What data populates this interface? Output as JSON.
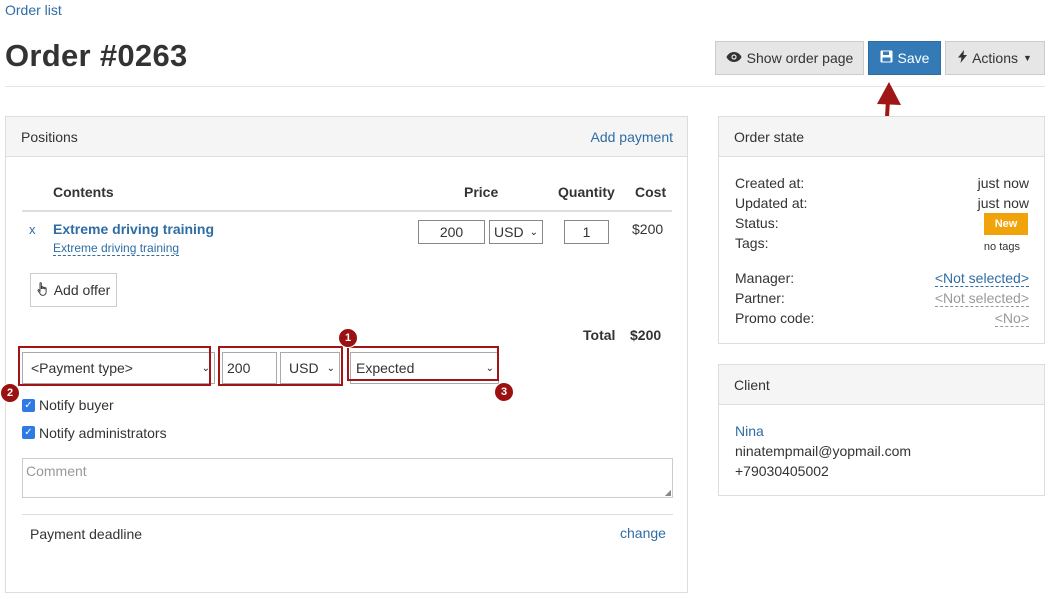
{
  "breadcrumb": {
    "order_list": "Order list"
  },
  "page": {
    "title": "Order #0263"
  },
  "toolbar": {
    "show_order_page": "Show order page",
    "save": "Save",
    "actions": "Actions"
  },
  "positions": {
    "heading": "Positions",
    "add_payment": "Add payment",
    "columns": {
      "contents": "Contents",
      "price": "Price",
      "quantity": "Quantity",
      "cost": "Cost"
    },
    "items": [
      {
        "remove": "x",
        "name": "Extreme driving training",
        "subtitle": "Extreme driving training",
        "price": "200",
        "currency": "USD",
        "quantity": "1",
        "cost": "$200"
      }
    ],
    "add_offer": "Add offer",
    "total_label": "Total",
    "total_value": "$200"
  },
  "payment": {
    "type_placeholder": "<Payment type>",
    "amount": "200",
    "currency": "USD",
    "status": "Expected",
    "notify_buyer": "Notify buyer",
    "notify_admins": "Notify administrators",
    "comment_placeholder": "Comment",
    "deadline_label": "Payment deadline",
    "deadline_change": "change"
  },
  "callouts": [
    "1",
    "2",
    "3"
  ],
  "order_state": {
    "heading": "Order state",
    "created_label": "Created at:",
    "created_value": "just now",
    "updated_label": "Updated at:",
    "updated_value": "just now",
    "status_label": "Status:",
    "status_value": "New",
    "tags_label": "Tags:",
    "tags_value": "no tags",
    "manager_label": "Manager:",
    "manager_value": "<Not selected>",
    "partner_label": "Partner:",
    "partner_value": "<Not selected>",
    "promo_label": "Promo code:",
    "promo_value": "<No>"
  },
  "client": {
    "heading": "Client",
    "name": "Nina",
    "email": "ninatempmail@yopmail.com",
    "phone": "+79030405002"
  },
  "colors": {
    "link": "#2e6da4",
    "primary": "#337ab7",
    "status_new": "#f0a30a",
    "annotation": "#a01616"
  },
  "icons": {
    "show_order_page": "eye-icon",
    "save": "floppy-disk-icon",
    "actions": "lightning-icon",
    "add_offer": "hand-pointer-icon"
  }
}
